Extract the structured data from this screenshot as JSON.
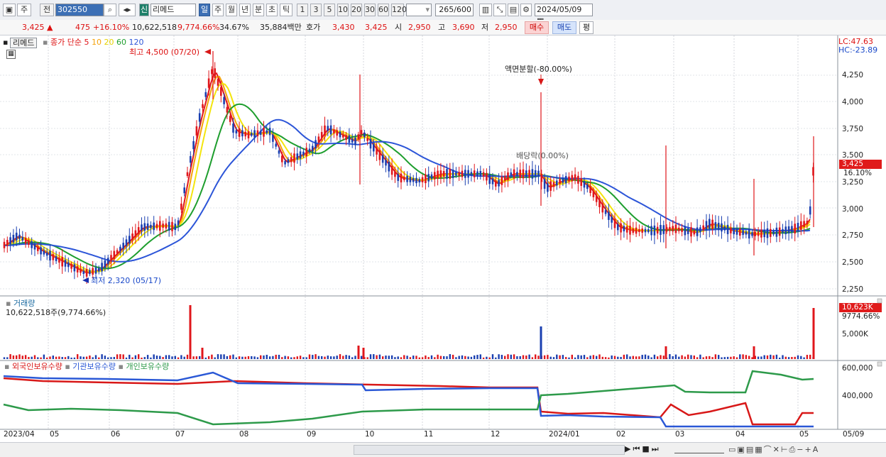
{
  "toolbar": {
    "period_label": "주",
    "compare_label": "전",
    "code_value": "302550",
    "name_value": "리메드",
    "credit_badge": "신",
    "periods": [
      "일",
      "주",
      "월",
      "년",
      "분",
      "초",
      "틱"
    ],
    "intervals": [
      "1",
      "3",
      "5",
      "10",
      "20",
      "30",
      "60",
      "120"
    ],
    "count_value": "265",
    "count_total": "/600",
    "date_value": "2024/05/09"
  },
  "quote": {
    "price": "3,425",
    "change": "475",
    "change_pct": "+16.10%",
    "volume": "10,622,518",
    "volume_ratio": "9,774.66%",
    "turnover": "34.67%",
    "amount": "35,884백만",
    "ask_label": "호가",
    "ask": "3,430",
    "bid": "3,425",
    "open_label": "시",
    "open": "2,950",
    "high_label": "고",
    "high": "3,690",
    "low_label": "저",
    "low": "2,950",
    "buy_label": "매수",
    "sell_label": "매도",
    "avg_label": "평"
  },
  "price_panel": {
    "name": "리메드",
    "series_label": "종가 단순",
    "ma_periods": [
      "5",
      "10",
      "20",
      "60",
      "120"
    ],
    "ma_colors": [
      "#e0161b",
      "#f5a20a",
      "#f3e50d",
      "#1e9e2e",
      "#2c55d8"
    ],
    "high_note": "최고 4,500 (07/20)",
    "low_note": "최저 2,320 (05/17)",
    "split_note": "액면분할(-80.00%)",
    "dividend_note": "배당락(0.00%)",
    "lc": "LC:47.63",
    "hc": "HC:-23.89",
    "y_ticks": [
      "4,250",
      "4,000",
      "3,750",
      "3,500",
      "3,250",
      "3,000",
      "2,750",
      "2,500",
      "2,250"
    ],
    "last_price": "3,425",
    "last_pct": "16.10%"
  },
  "volume_panel": {
    "title": "거래량",
    "value": "10,622,518주(9,774.66%)",
    "last_badge": "10,623K",
    "last_pct": "9774.66%",
    "y_tick": "5,000K"
  },
  "holdings_panel": {
    "legend": [
      "외국인보유수량",
      "기관보유수량",
      "개인보유수량"
    ],
    "colors": [
      "#d81818",
      "#2a58d6",
      "#2d9a4a"
    ],
    "y_ticks": [
      "600,000",
      "400,000"
    ]
  },
  "x_axis": [
    "2023/04",
    "05",
    "06",
    "07",
    "08",
    "09",
    "10",
    "11",
    "12",
    "2024/01",
    "02",
    "03",
    "04",
    "05",
    "05/09"
  ]
}
